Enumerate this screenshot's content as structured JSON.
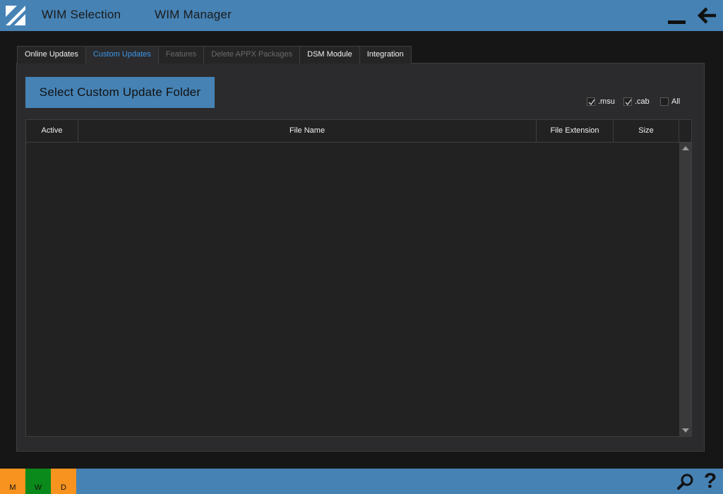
{
  "topbar": {
    "nav_wim_selection": "WIM Selection",
    "nav_wim_manager": "WIM Manager"
  },
  "tabs": [
    {
      "label": "Online Updates",
      "state": "normal"
    },
    {
      "label": "Custom Updates",
      "state": "active"
    },
    {
      "label": "Features",
      "state": "disabled"
    },
    {
      "label": "Delete APPX Packages",
      "state": "disabled"
    },
    {
      "label": "DSM Module",
      "state": "normal"
    },
    {
      "label": "Integration",
      "state": "normal"
    }
  ],
  "custom_updates": {
    "select_folder_label": "Select Custom Update Folder",
    "filters": {
      "msu": {
        "label": ".msu",
        "checked": true
      },
      "cab": {
        "label": ".cab",
        "checked": true
      },
      "all": {
        "label": "All",
        "checked": false
      }
    },
    "grid": {
      "columns": [
        "Active",
        "File Name",
        "File Extension",
        "Size"
      ],
      "rows": []
    }
  },
  "bottombar": {
    "badges": [
      {
        "letter": "M",
        "color": "#f7931e"
      },
      {
        "letter": "W",
        "color": "#0a8a1a"
      },
      {
        "letter": "D",
        "color": "#f7931e"
      }
    ],
    "help_glyph": "?"
  },
  "colors": {
    "accent": "#4682b4",
    "active_tab_text": "#3d97e8",
    "background": "#161616",
    "panel": "#2b2b2e"
  },
  "icons": {
    "logo": "app-logo-icon",
    "minimize": "minimize-icon",
    "back": "back-arrow-icon",
    "search": "search-icon",
    "help": "help-icon"
  }
}
